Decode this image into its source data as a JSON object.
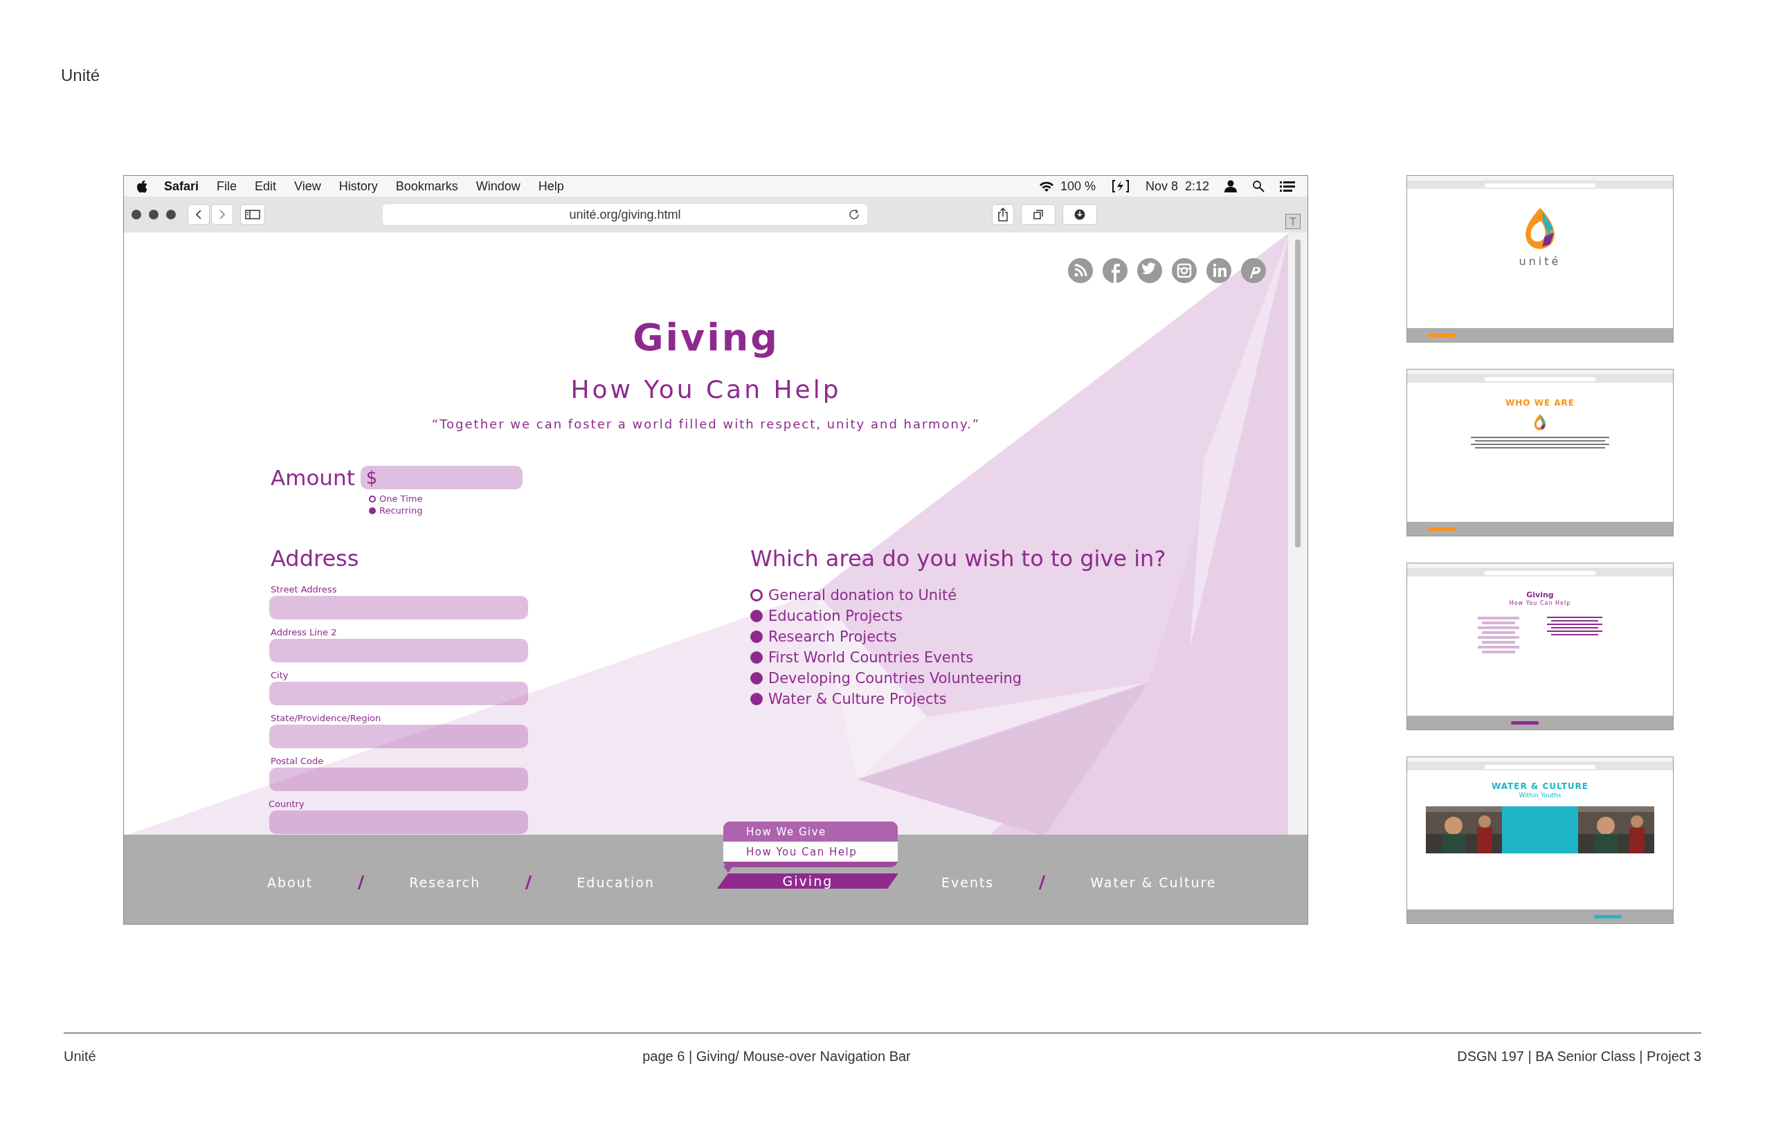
{
  "page_title": "Unité",
  "browser": {
    "menu_bar": {
      "app": "Safari",
      "menus": [
        "File",
        "Edit",
        "View",
        "History",
        "Bookmarks",
        "Window",
        "Help"
      ],
      "battery": "100 %",
      "date": "Nov 8",
      "time": "2:12"
    },
    "address": "unité.org/giving.html"
  },
  "site": {
    "title": "Giving",
    "subtitle": "How You Can Help",
    "quote": "“Together we can foster a world filled with respect, unity and harmony.”",
    "amount": {
      "label": "Amount",
      "currency": "$",
      "options": [
        {
          "label": "One Time",
          "selected": false
        },
        {
          "label": "Recurring",
          "selected": true
        }
      ]
    },
    "address": {
      "heading": "Address",
      "fields": [
        {
          "label": "Street Address"
        },
        {
          "label": "Address Line 2"
        },
        {
          "label": "City"
        },
        {
          "label": "State/Providence/Region"
        },
        {
          "label": "Postal Code"
        },
        {
          "label": "Country"
        }
      ]
    },
    "areas": {
      "heading": "Which area do you wish to to give in?",
      "options": [
        {
          "label": "General donation to Unité",
          "selected": false
        },
        {
          "label": "Education Projects",
          "selected": true
        },
        {
          "label": "Research Projects",
          "selected": true
        },
        {
          "label": "First World Countries Events",
          "selected": true
        },
        {
          "label": "Developing Countries Volunteering",
          "selected": true
        },
        {
          "label": "Water & Culture Projects",
          "selected": true
        }
      ]
    },
    "nav": {
      "items": [
        {
          "label": "About",
          "selected": false
        },
        {
          "label": "Research",
          "selected": false
        },
        {
          "label": "Education",
          "selected": false
        },
        {
          "label": "Giving",
          "selected": true
        },
        {
          "label": "Events",
          "selected": false
        },
        {
          "label": "Water & Culture",
          "selected": false
        }
      ],
      "dropdown": [
        {
          "label": "How We Give",
          "highlighted": true
        },
        {
          "label": "How You Can Help",
          "highlighted": false
        }
      ]
    }
  },
  "thumbnails": [
    {
      "kind": "logo",
      "heading": "unité"
    },
    {
      "kind": "text",
      "heading": "WHO WE ARE"
    },
    {
      "kind": "form",
      "heading": "Giving",
      "subheading": "How You Can Help"
    },
    {
      "kind": "photos",
      "heading": "WATER & CULTURE",
      "subheading": "Within Youths"
    }
  ],
  "footer": {
    "left": "Unité",
    "center": "page 6  | Giving/ Mouse-over Navigation Bar",
    "right": "DSGN 197 | BA Senior Class | Project 3"
  }
}
